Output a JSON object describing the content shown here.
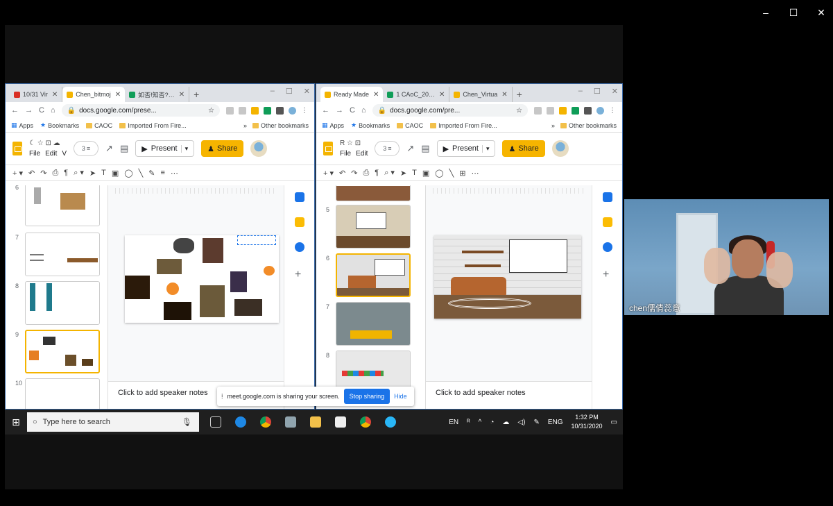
{
  "outer": {
    "minimize": "–",
    "maximize": "☐",
    "close": "✕"
  },
  "left_browser": {
    "tabs": [
      {
        "label": "10/31 Vir",
        "favicon_color": "#d93025"
      },
      {
        "label": "Chen_bitmoj",
        "favicon_color": "#f4b400"
      },
      {
        "label": "如否!知否?…",
        "favicon_color": "#0f9d58"
      }
    ],
    "url": "docs.google.com/prese...",
    "bookmarks": [
      "Apps",
      "Bookmarks",
      "CAOC",
      "Imported From Fire..."
    ],
    "other_bookmarks": "Other bookmarks",
    "menu": [
      "File",
      "Edit",
      "V"
    ],
    "present": "Present",
    "share": "Share",
    "slide_numbers": [
      "6",
      "7",
      "8",
      "9",
      "10"
    ],
    "notes": "Click to add speaker notes"
  },
  "right_browser": {
    "tabs": [
      {
        "label": "Ready Made",
        "favicon_color": "#f4b400"
      },
      {
        "label": "1 CAoC_20…",
        "favicon_color": "#0f9d58"
      },
      {
        "label": "Chen_Virtua",
        "favicon_color": "#f4b400"
      }
    ],
    "url": "docs.google.com/pre...",
    "bookmarks": [
      "Apps",
      "Bookmarks",
      "CAOC",
      "Imported From Fire..."
    ],
    "other_bookmarks": "Other bookmarks",
    "menu": [
      "File",
      "Edit"
    ],
    "present": "Present",
    "share": "Share",
    "slide_numbers": [
      "5",
      "6",
      "7",
      "8"
    ],
    "notes": "Click to add speaker notes"
  },
  "meet_banner": {
    "message": "meet.google.com is sharing your screen.",
    "stop": "Stop sharing",
    "hide": "Hide"
  },
  "taskbar": {
    "search_placeholder": "Type here to search",
    "lang_top": "EN",
    "lang": "ENG",
    "time": "1:32 PM",
    "date": "10/31/2020"
  },
  "video": {
    "name": "chen儒倩蕊意"
  },
  "colors": {
    "accent_yellow": "#f4b400",
    "meet_blue": "#1a73e8"
  }
}
